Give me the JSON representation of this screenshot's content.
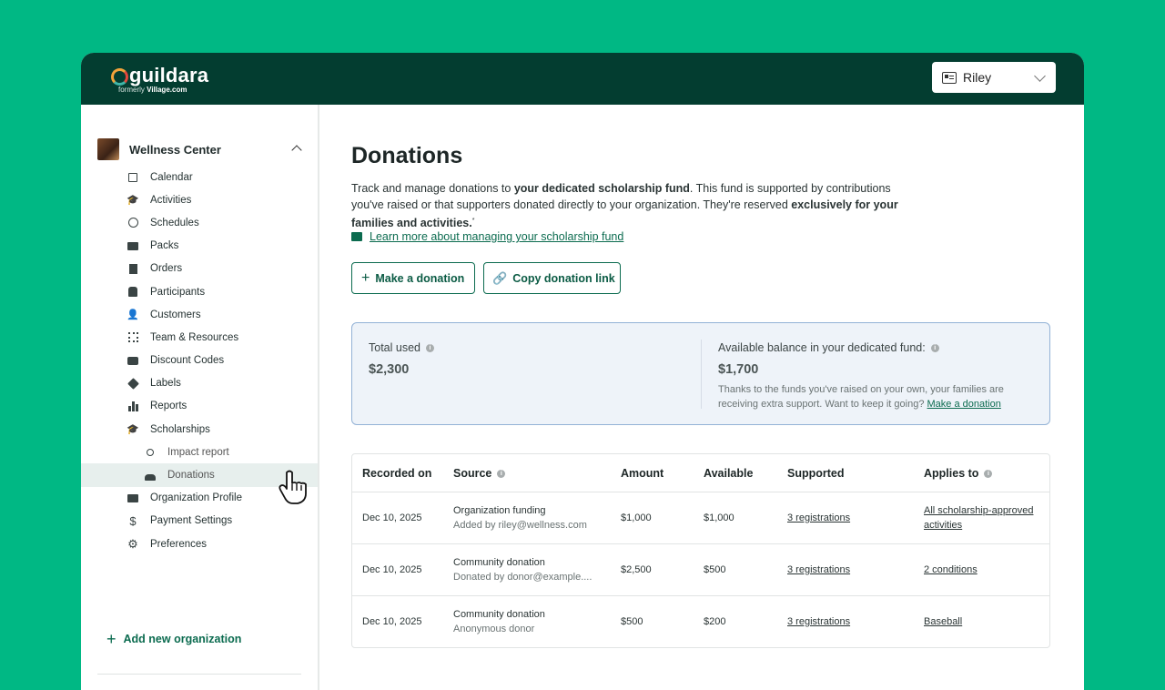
{
  "app": {
    "brand": "guildara",
    "brand_sub_prefix": "formerly",
    "brand_sub_name": "Village.com",
    "user_name": "Riley"
  },
  "sidebar": {
    "org_name": "Wellness Center",
    "items": [
      {
        "label": "Calendar",
        "icon": "calendar-icon"
      },
      {
        "label": "Activities",
        "icon": "graduation-cap-icon"
      },
      {
        "label": "Schedules",
        "icon": "clock-icon"
      },
      {
        "label": "Packs",
        "icon": "ticket-icon"
      },
      {
        "label": "Orders",
        "icon": "receipt-icon"
      },
      {
        "label": "Participants",
        "icon": "participant-icon"
      },
      {
        "label": "Customers",
        "icon": "person-icon"
      },
      {
        "label": "Team & Resources",
        "icon": "team-icon"
      },
      {
        "label": "Discount Codes",
        "icon": "discount-icon"
      },
      {
        "label": "Labels",
        "icon": "tag-icon"
      },
      {
        "label": "Reports",
        "icon": "bar-chart-icon"
      },
      {
        "label": "Scholarships",
        "icon": "graduation-cap-icon"
      },
      {
        "label": "Impact report",
        "icon": "search-icon"
      },
      {
        "label": "Donations",
        "icon": "donation-hand-icon"
      },
      {
        "label": "Organization Profile",
        "icon": "id-card-icon"
      },
      {
        "label": "Payment Settings",
        "icon": "dollar-icon"
      },
      {
        "label": "Preferences",
        "icon": "gear-icon"
      }
    ],
    "add_org_label": "Add new organization"
  },
  "main": {
    "title": "Donations",
    "desc_1": "Track and manage donations to ",
    "desc_bold_1": "your dedicated scholarship fund",
    "desc_2": ". This fund is supported by contributions you've raised or that supporters donated directly to your organization. They're reserved ",
    "desc_bold_2": "exclusively for your families and activities.",
    "desc_mark": "*",
    "learn_link": "Learn more about managing your scholarship fund",
    "make_donation": "Make a donation",
    "copy_link": "Copy donation link",
    "summary": {
      "total_used_label": "Total used",
      "total_used_value": "$2,300",
      "available_label": "Available balance in your dedicated fund:",
      "available_value": "$1,700",
      "note": "Thanks to the funds you've raised on your own, your families are receiving extra support. Want to keep it going?",
      "note_link": "Make a donation"
    },
    "table": {
      "headers": [
        "Recorded on",
        "Source",
        "Amount",
        "Available",
        "Supported",
        "Applies to"
      ],
      "rows": [
        {
          "date": "Dec 10, 2025",
          "source": "Organization funding",
          "source_sub": "Added by riley@wellness.com",
          "amount": "$1,000",
          "available": "$1,000",
          "supported": "3 registrations",
          "applies": "All scholarship-approved activities"
        },
        {
          "date": "Dec 10, 2025",
          "source": "Community donation",
          "source_sub": "Donated by donor@example....",
          "amount": "$2,500",
          "available": "$500",
          "supported": "3 registrations",
          "applies": "2 conditions"
        },
        {
          "date": "Dec 10, 2025",
          "source": "Community donation",
          "source_sub": "Anonymous donor",
          "amount": "$500",
          "available": "$200",
          "supported": "3 registrations",
          "applies": "Baseball"
        }
      ]
    }
  },
  "colors": {
    "background": "#00b884",
    "topbar": "#033d30",
    "accent": "#0b6b4f",
    "summary_bg": "#eef3f9",
    "summary_border": "#93b2d6"
  }
}
